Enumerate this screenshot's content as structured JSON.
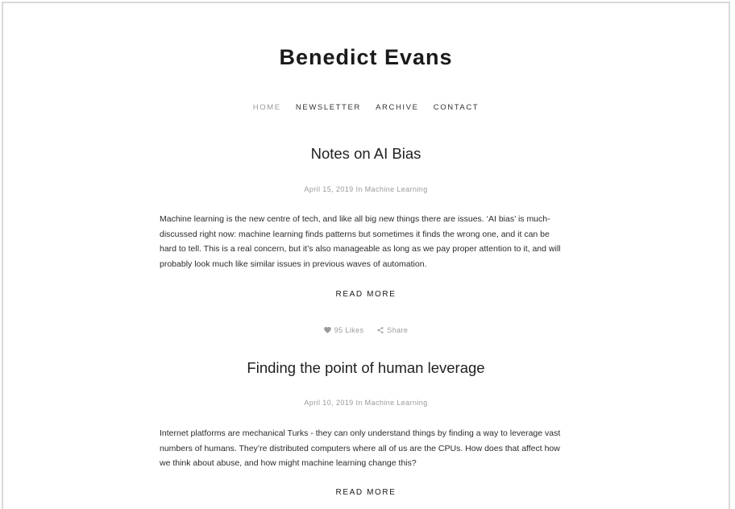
{
  "site": {
    "title": "Benedict Evans"
  },
  "nav": {
    "items": [
      {
        "label": "HOME"
      },
      {
        "label": "NEWSLETTER"
      },
      {
        "label": "ARCHIVE"
      },
      {
        "label": "CONTACT"
      }
    ]
  },
  "posts": [
    {
      "title": "Notes on AI Bias",
      "date": "April 15, 2019",
      "in_label": "In",
      "category": "Machine Learning",
      "excerpt_lines": [
        "Machine learning is the new centre of tech, and like all big new things there are issues. ‘AI bias’ is much-",
        "discussed right now:  machine learning finds patterns but sometimes it finds the wrong one, and it can be",
        "hard to tell. This is a real concern, but it’s also manageable as long as we pay proper attention to it, and will",
        "probably look much like similar issues in previous waves of automation."
      ],
      "read_more": "READ MORE",
      "likes": "95 Likes",
      "share": "Share"
    },
    {
      "title": "Finding the point of human leverage",
      "date": "April 10, 2019",
      "in_label": "In",
      "category": "Machine Learning",
      "excerpt_lines": [
        "Internet platforms are mechanical Turks - they can only understand things by finding a way to leverage vast",
        "numbers of humans. They’re distributed computers where all of us are the CPUs. How does that affect how",
        "we think about abuse, and how might machine learning change this?"
      ],
      "read_more": "READ MORE"
    }
  ],
  "icons": {
    "like": "heart-icon",
    "share": "share-icon"
  },
  "colors": {
    "text": "#1a1a1a",
    "muted": "#9a9a9a",
    "frame_border": "#d9d9d9"
  }
}
